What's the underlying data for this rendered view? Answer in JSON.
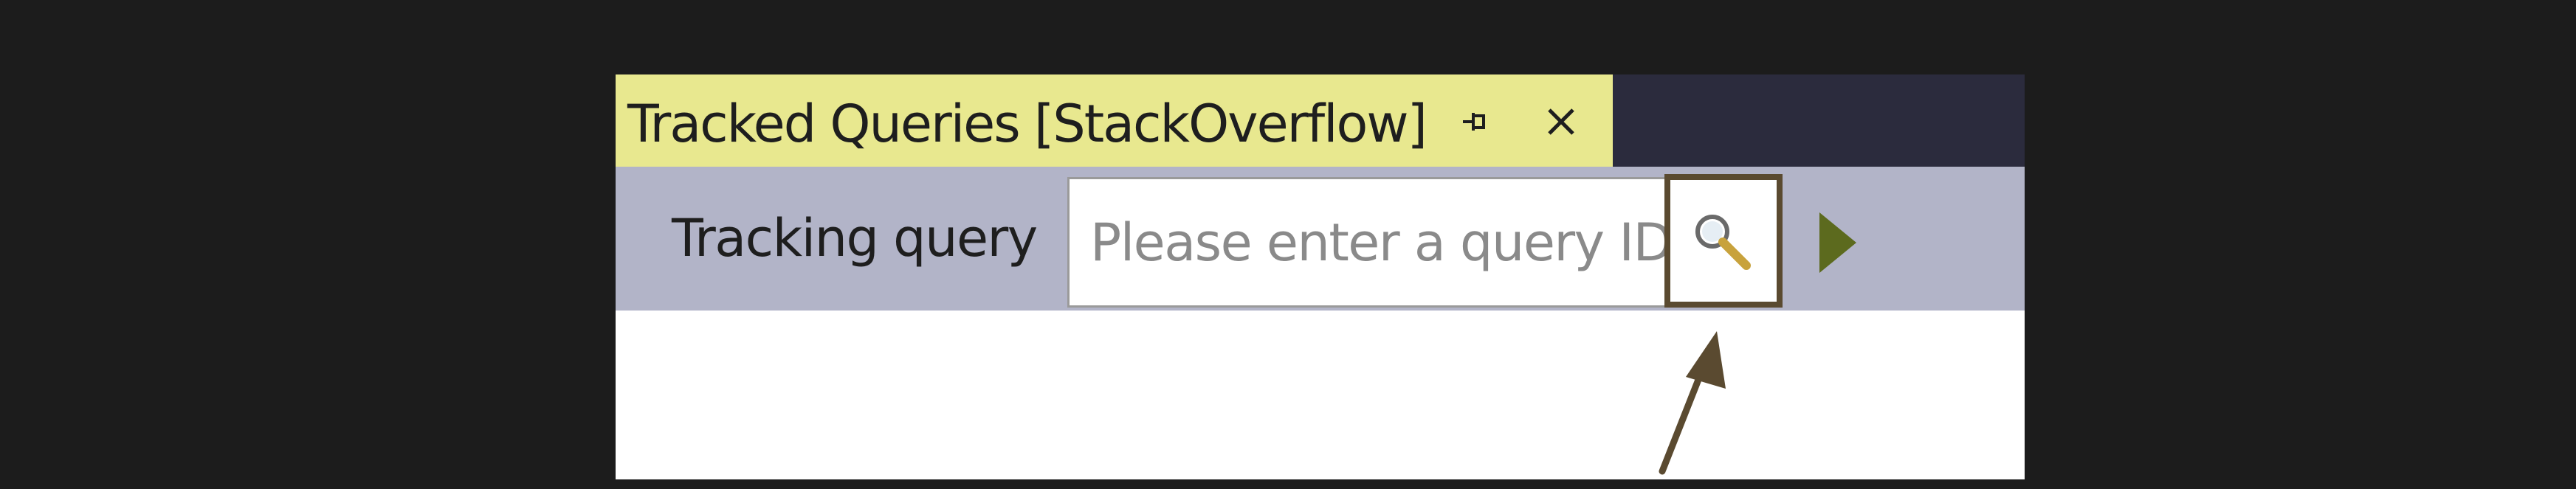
{
  "window": {
    "tab_title": "Tracked Queries [StackOverflow]",
    "pin_icon": "pin-icon",
    "close_icon": "close-icon"
  },
  "toolbar": {
    "tracking_label": "Tracking query",
    "query_input": {
      "value": "",
      "placeholder": "Please enter a query ID"
    },
    "search_icon": "search-icon",
    "run_icon": "play-icon"
  },
  "colors": {
    "background": "#1c1c1c",
    "tab_active": "#e8e88f",
    "tabstrip": "#2b2b3d",
    "toolbar": "#b2b4c8",
    "highlight_border": "#5a4a30",
    "run_icon": "#5c6a1e",
    "search_icon_lens": "#6a6a6a",
    "search_icon_handle": "#c8a23c"
  }
}
